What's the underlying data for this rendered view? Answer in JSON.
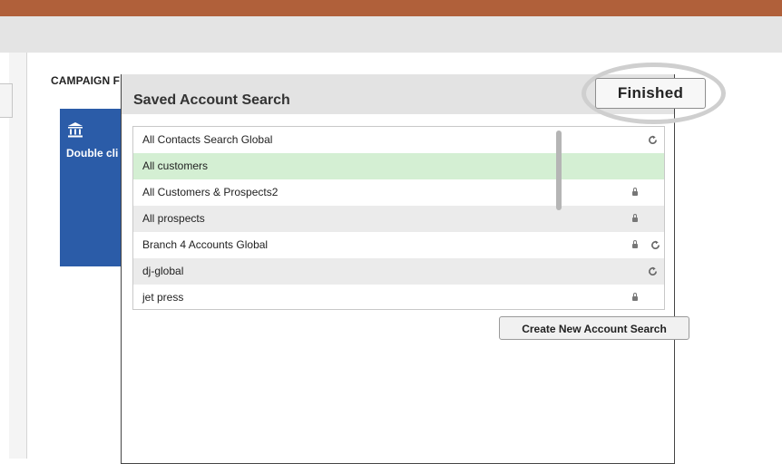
{
  "campaign": {
    "title": "CAMPAIGN F",
    "tile_text": "Double cli",
    "tile_icon": "bank-icon"
  },
  "dialog": {
    "title": "Saved Account Search",
    "finished_label": "Finished",
    "create_label": "Create New Account Search",
    "searches": [
      {
        "label": "All Contacts Search Global",
        "locked": false,
        "global": true,
        "selected": false
      },
      {
        "label": "All customers",
        "locked": false,
        "global": false,
        "selected": true
      },
      {
        "label": "All Customers & Prospects2",
        "locked": true,
        "global": false,
        "selected": false
      },
      {
        "label": "All prospects",
        "locked": true,
        "global": false,
        "selected": false
      },
      {
        "label": "Branch 4 Accounts Global",
        "locked": true,
        "global": true,
        "selected": false
      },
      {
        "label": "dj-global",
        "locked": false,
        "global": true,
        "selected": false
      },
      {
        "label": "jet press",
        "locked": true,
        "global": false,
        "selected": false
      }
    ]
  },
  "colors": {
    "top_bar": "#b0603a",
    "tile_blue": "#2b5ca8",
    "selected_row": "#d4efd3"
  }
}
